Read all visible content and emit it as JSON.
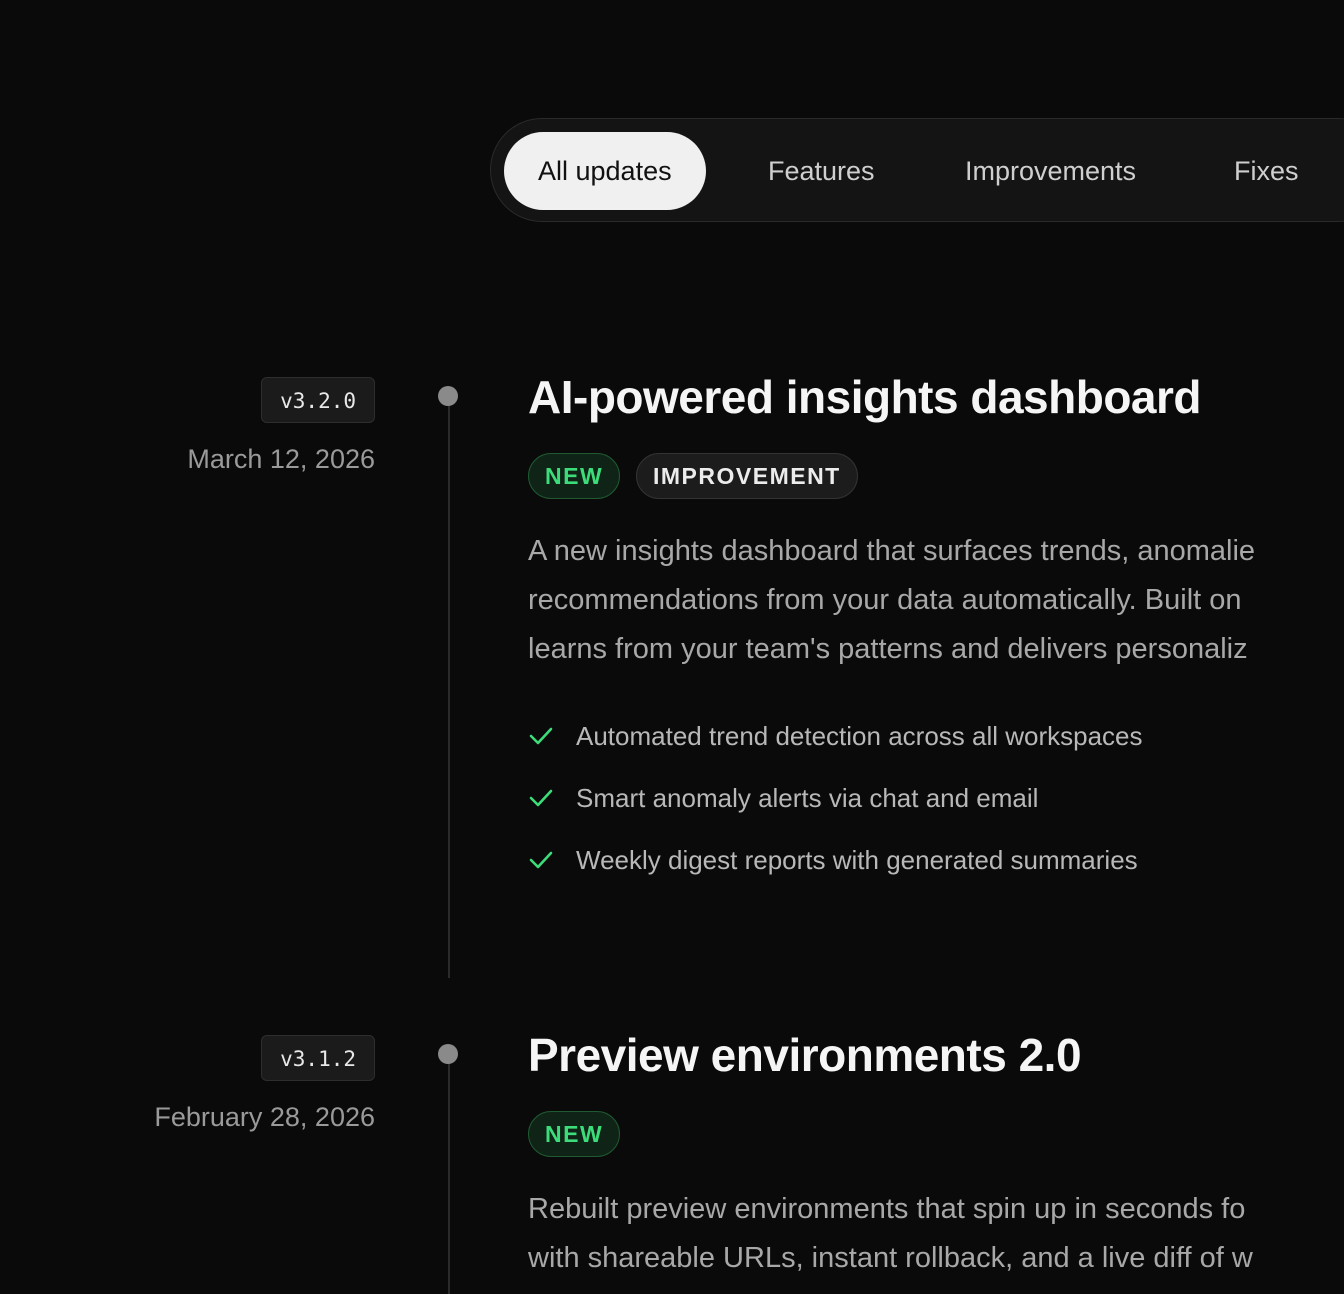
{
  "filters": {
    "tabs": [
      "All updates",
      "Features",
      "Improvements",
      "Fixes"
    ],
    "active": "All updates"
  },
  "entries": [
    {
      "version": "v3.2.0",
      "date": "March 12, 2026",
      "title": "AI-powered insights dashboard",
      "badges": [
        "NEW",
        "IMPROVEMENT"
      ],
      "description": [
        "A new insights dashboard that surfaces trends, anomalie",
        "recommendations from your data automatically. Built on",
        "learns from your team's patterns and delivers personaliz"
      ],
      "features": [
        "Automated trend detection across all workspaces",
        "Smart anomaly alerts via chat and email",
        "Weekly digest reports with generated summaries"
      ]
    },
    {
      "version": "v3.1.2",
      "date": "February 28, 2026",
      "title": "Preview environments 2.0",
      "badges": [
        "NEW"
      ],
      "description": [
        "Rebuilt preview environments that spin up in seconds fo",
        "with shareable URLs, instant rollback, and a live diff of w"
      ]
    }
  ],
  "colors": {
    "background": "#0a0a0a",
    "accent_green": "#3ddc7a",
    "check_icon": "check-icon"
  }
}
